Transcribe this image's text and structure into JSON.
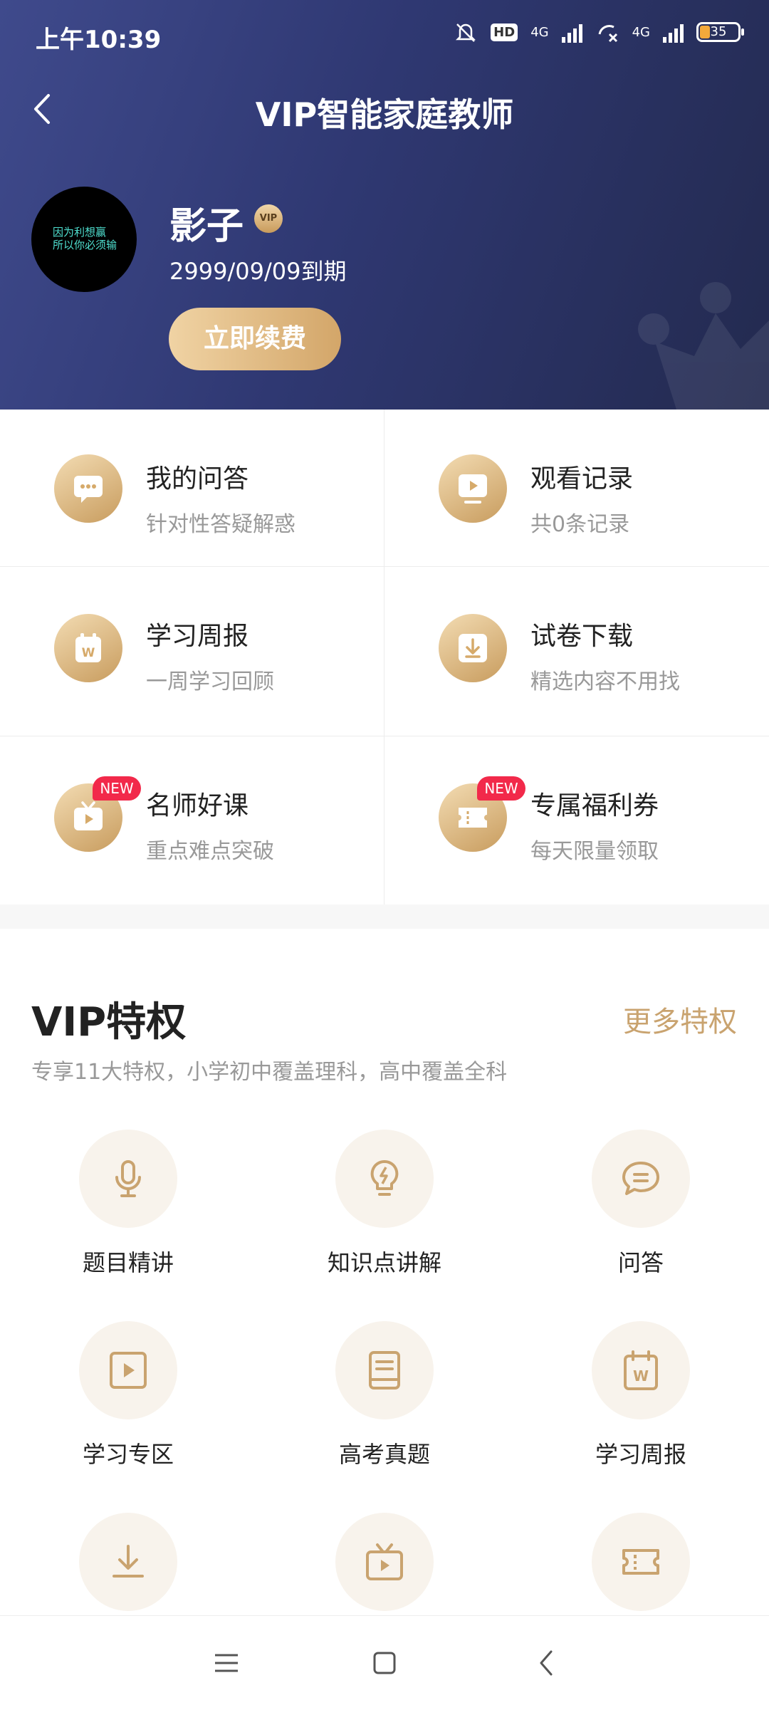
{
  "status_bar": {
    "time": "上午10:39",
    "battery": "35",
    "hd": "HD",
    "net1": "4G",
    "net2": "4G"
  },
  "header": {
    "title": "VIP智能家庭教师",
    "user_name": "影子",
    "vip_badge": "VIP",
    "expire": "2999/09/09到期",
    "renew_button": "立即续费",
    "avatar_text_line1": "因为利想赢",
    "avatar_text_line2": "所以你必须输"
  },
  "features": [
    {
      "title": "我的问答",
      "subtitle": "针对性答疑解惑",
      "icon": "chat-icon",
      "badge": ""
    },
    {
      "title": "观看记录",
      "subtitle": "共0条记录",
      "icon": "video-history-icon",
      "badge": ""
    },
    {
      "title": "学习周报",
      "subtitle": "一周学习回顾",
      "icon": "weekly-report-icon",
      "badge": ""
    },
    {
      "title": "试卷下载",
      "subtitle": "精选内容不用找",
      "icon": "download-icon",
      "badge": ""
    },
    {
      "title": "名师好课",
      "subtitle": "重点难点突破",
      "icon": "tv-icon",
      "badge": "NEW"
    },
    {
      "title": "专属福利券",
      "subtitle": "每天限量领取",
      "icon": "coupon-icon",
      "badge": "NEW"
    }
  ],
  "privileges": {
    "title": "VIP特权",
    "more_link": "更多特权",
    "description": "专享11大特权，小学初中覆盖理科，高中覆盖全科",
    "items": [
      {
        "label": "题目精讲",
        "icon": "microphone-icon"
      },
      {
        "label": "知识点讲解",
        "icon": "lightbulb-icon"
      },
      {
        "label": "问答",
        "icon": "message-icon"
      },
      {
        "label": "学习专区",
        "icon": "play-icon"
      },
      {
        "label": "高考真题",
        "icon": "book-icon"
      },
      {
        "label": "学习周报",
        "icon": "calendar-icon"
      },
      {
        "label": "",
        "icon": "download-icon"
      },
      {
        "label": "",
        "icon": "tv-icon"
      },
      {
        "label": "",
        "icon": "coupon-icon"
      }
    ]
  },
  "colors": {
    "header_start": "#3f4a8c",
    "header_end": "#232a4f",
    "gold": "#c9a36f",
    "new_badge": "#f2294a"
  }
}
